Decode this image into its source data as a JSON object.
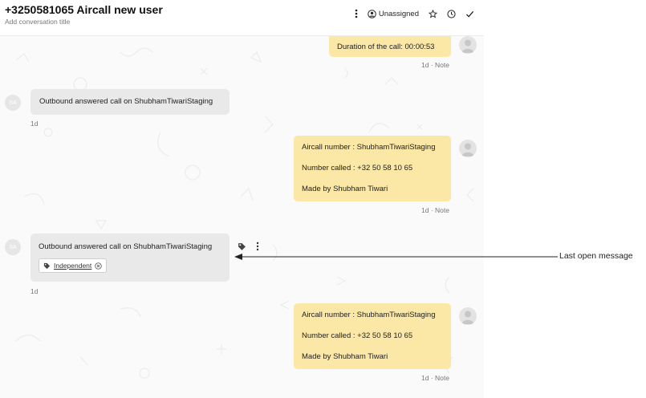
{
  "header": {
    "title": "+3250581065 Aircall new user",
    "subtitle": "Add conversation title",
    "assignee_label": "Unassigned"
  },
  "messages": [
    {
      "kind": "note",
      "lines": [
        "Duration of the call: 00:00:53"
      ],
      "meta": "1d · Note"
    },
    {
      "kind": "call",
      "avatar": "SA",
      "text": "Outbound answered call on ShubhamTiwariStaging",
      "time": "1d"
    },
    {
      "kind": "note",
      "lines": [
        "Aircall number : ShubhamTiwariStaging",
        "Number called : +32 50 58 10 65",
        "Made by Shubham Tiwari"
      ],
      "meta": "1d · Note"
    },
    {
      "kind": "call",
      "avatar": "SA",
      "text": "Outbound answered call on ShubhamTiwariStaging",
      "tag": "Independent",
      "time": "1d"
    },
    {
      "kind": "note",
      "lines": [
        "Aircall number : ShubhamTiwariStaging",
        "Number called : +32 50 58 10 65",
        "Made by Shubham Tiwari"
      ],
      "meta": "1d · Note"
    }
  ],
  "annotation": {
    "label": "Last open message"
  },
  "icons": {
    "header": [
      "kebab-menu-icon",
      "user-circle-icon",
      "star-icon",
      "clock-icon",
      "checkmark-icon"
    ],
    "message": [
      "tag-icon",
      "kebab-menu-icon",
      "close-circle-icon"
    ]
  },
  "colors": {
    "note_bubble": "#fbe7a6",
    "call_bubble": "#e9e9e9",
    "background": "#fafafa"
  }
}
